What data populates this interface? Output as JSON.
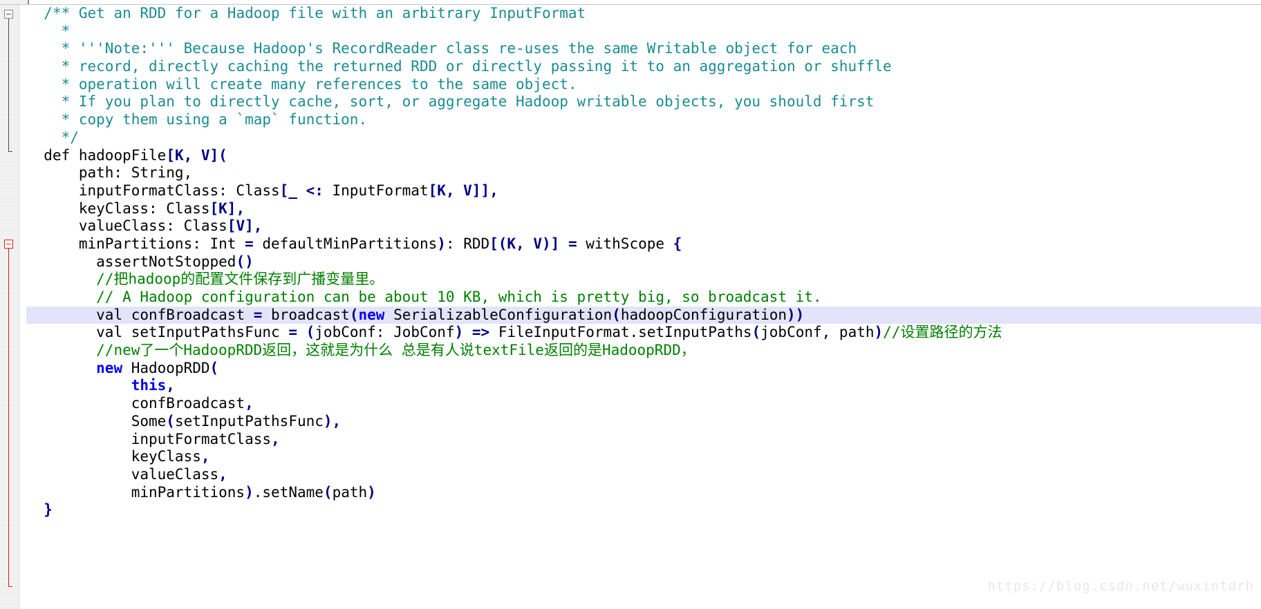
{
  "editor": {
    "language": "scala",
    "colors": {
      "background": "#ffffff",
      "doc_comment": "#1a8c93",
      "line_comment": "#008000",
      "keyword": "#0000ee",
      "punctuation": "#000080",
      "plain_text": "#000000",
      "highlight_line_background": "#e4e3fa",
      "gutter_background": "#f1f1f1",
      "fold_marker_active": "#e01b1b",
      "fold_marker_inactive": "#868686",
      "watermark": "#e8e8e3"
    },
    "highlighted_line_index": 17,
    "watermark": "https://blog.csdn.net/wuxintdrh",
    "fold_markers": [
      {
        "name": "doc-comment-fold",
        "state": "expanded",
        "color": "gray"
      },
      {
        "name": "method-body-fold",
        "state": "expanded",
        "color": "red"
      }
    ],
    "lines": [
      {
        "indent": 1,
        "tokens": [
          {
            "t": "doc",
            "v": "/** Get an RDD for a Hadoop file with an arbitrary InputFormat"
          }
        ]
      },
      {
        "indent": 2,
        "tokens": [
          {
            "t": "doc",
            "v": "*"
          }
        ]
      },
      {
        "indent": 2,
        "tokens": [
          {
            "t": "doc",
            "v": "* '''Note:''' Because Hadoop's RecordReader class re-uses the same Writable object for each"
          }
        ]
      },
      {
        "indent": 2,
        "tokens": [
          {
            "t": "doc",
            "v": "* record, directly caching the returned RDD or directly passing it to an aggregation or shuffle"
          }
        ]
      },
      {
        "indent": 2,
        "tokens": [
          {
            "t": "doc",
            "v": "* operation will create many references to the same object."
          }
        ]
      },
      {
        "indent": 2,
        "tokens": [
          {
            "t": "doc",
            "v": "* If you plan to directly cache, sort, or aggregate Hadoop writable objects, you should first"
          }
        ]
      },
      {
        "indent": 2,
        "tokens": [
          {
            "t": "doc",
            "v": "* copy them using a `map` function."
          }
        ]
      },
      {
        "indent": 2,
        "tokens": [
          {
            "t": "doc",
            "v": "*/"
          }
        ]
      },
      {
        "indent": 1,
        "tokens": [
          {
            "t": "plain",
            "v": "def hadoopFile"
          },
          {
            "t": "punct",
            "v": "[K, V]("
          }
        ]
      },
      {
        "indent": 3,
        "tokens": [
          {
            "t": "plain",
            "v": "path: String,"
          }
        ]
      },
      {
        "indent": 3,
        "tokens": [
          {
            "t": "plain",
            "v": "inputFormatClass: Class"
          },
          {
            "t": "punct",
            "v": "[_ <:"
          },
          {
            "t": "plain",
            "v": " InputFormat"
          },
          {
            "t": "punct",
            "v": "[K, V]],"
          }
        ]
      },
      {
        "indent": 3,
        "tokens": [
          {
            "t": "plain",
            "v": "keyClass: Class"
          },
          {
            "t": "punct",
            "v": "[K],"
          }
        ]
      },
      {
        "indent": 3,
        "tokens": [
          {
            "t": "plain",
            "v": "valueClass: Class"
          },
          {
            "t": "punct",
            "v": "[V],"
          }
        ]
      },
      {
        "indent": 3,
        "tokens": [
          {
            "t": "plain",
            "v": "minPartitions: Int "
          },
          {
            "t": "op",
            "v": "="
          },
          {
            "t": "plain",
            "v": " defaultMinPartitions"
          },
          {
            "t": "punct",
            "v": ")"
          },
          {
            "t": "plain",
            "v": ": RDD"
          },
          {
            "t": "punct",
            "v": "[(K, V)]"
          },
          {
            "t": "plain",
            "v": " "
          },
          {
            "t": "op",
            "v": "="
          },
          {
            "t": "plain",
            "v": " withScope "
          },
          {
            "t": "punct",
            "v": "{"
          }
        ]
      },
      {
        "indent": 4,
        "tokens": [
          {
            "t": "plain",
            "v": "assertNotStopped"
          },
          {
            "t": "punct",
            "v": "()"
          }
        ]
      },
      {
        "indent": 4,
        "tokens": [
          {
            "t": "comment",
            "v": "//把hadoop的配置文件保存到广播变量里。"
          }
        ]
      },
      {
        "indent": 4,
        "tokens": [
          {
            "t": "comment",
            "v": "// A Hadoop configuration can be about 10 KB, which is pretty big, so broadcast it."
          }
        ]
      },
      {
        "indent": 4,
        "tokens": [
          {
            "t": "plain",
            "v": "val confBroadcast "
          },
          {
            "t": "op",
            "v": "="
          },
          {
            "t": "plain",
            "v": " broadcast"
          },
          {
            "t": "punct",
            "v": "("
          },
          {
            "t": "kw",
            "v": "new"
          },
          {
            "t": "plain",
            "v": " SerializableConfiguration"
          },
          {
            "t": "punct",
            "v": "("
          },
          {
            "t": "plain",
            "v": "hadoopConfiguration"
          },
          {
            "t": "punct",
            "v": "))"
          }
        ]
      },
      {
        "indent": 4,
        "tokens": [
          {
            "t": "plain",
            "v": "val setInputPathsFunc "
          },
          {
            "t": "op",
            "v": "="
          },
          {
            "t": "plain",
            "v": " "
          },
          {
            "t": "punct",
            "v": "("
          },
          {
            "t": "plain",
            "v": "jobConf: JobConf"
          },
          {
            "t": "punct",
            "v": ")"
          },
          {
            "t": "plain",
            "v": " "
          },
          {
            "t": "op",
            "v": "=>"
          },
          {
            "t": "plain",
            "v": " FileInputFormat.setInputPaths"
          },
          {
            "t": "punct",
            "v": "("
          },
          {
            "t": "plain",
            "v": "jobConf, path"
          },
          {
            "t": "punct",
            "v": ")"
          },
          {
            "t": "comment",
            "v": "//设置路径的方法"
          }
        ]
      },
      {
        "indent": 4,
        "tokens": [
          {
            "t": "comment",
            "v": "//new了一个HadoopRDD返回，这就是为什么 总是有人说textFile返回的是HadoopRDD，"
          }
        ]
      },
      {
        "indent": 4,
        "tokens": [
          {
            "t": "kw",
            "v": "new"
          },
          {
            "t": "plain",
            "v": " HadoopRDD"
          },
          {
            "t": "punct",
            "v": "("
          }
        ]
      },
      {
        "indent": 6,
        "tokens": [
          {
            "t": "kw",
            "v": "this"
          },
          {
            "t": "punct",
            "v": ","
          }
        ]
      },
      {
        "indent": 6,
        "tokens": [
          {
            "t": "plain",
            "v": "confBroadcast"
          },
          {
            "t": "punct",
            "v": ","
          }
        ]
      },
      {
        "indent": 6,
        "tokens": [
          {
            "t": "plain",
            "v": "Some"
          },
          {
            "t": "punct",
            "v": "("
          },
          {
            "t": "plain",
            "v": "setInputPathsFunc"
          },
          {
            "t": "punct",
            "v": "),"
          }
        ]
      },
      {
        "indent": 6,
        "tokens": [
          {
            "t": "plain",
            "v": "inputFormatClass"
          },
          {
            "t": "punct",
            "v": ","
          }
        ]
      },
      {
        "indent": 6,
        "tokens": [
          {
            "t": "plain",
            "v": "keyClass"
          },
          {
            "t": "punct",
            "v": ","
          }
        ]
      },
      {
        "indent": 6,
        "tokens": [
          {
            "t": "plain",
            "v": "valueClass"
          },
          {
            "t": "punct",
            "v": ","
          }
        ]
      },
      {
        "indent": 6,
        "tokens": [
          {
            "t": "plain",
            "v": "minPartitions"
          },
          {
            "t": "punct",
            "v": ")"
          },
          {
            "t": "plain",
            "v": ".setName"
          },
          {
            "t": "punct",
            "v": "("
          },
          {
            "t": "plain",
            "v": "path"
          },
          {
            "t": "punct",
            "v": ")"
          }
        ]
      },
      {
        "indent": 1,
        "tokens": [
          {
            "t": "punct",
            "v": "}"
          }
        ]
      }
    ]
  }
}
